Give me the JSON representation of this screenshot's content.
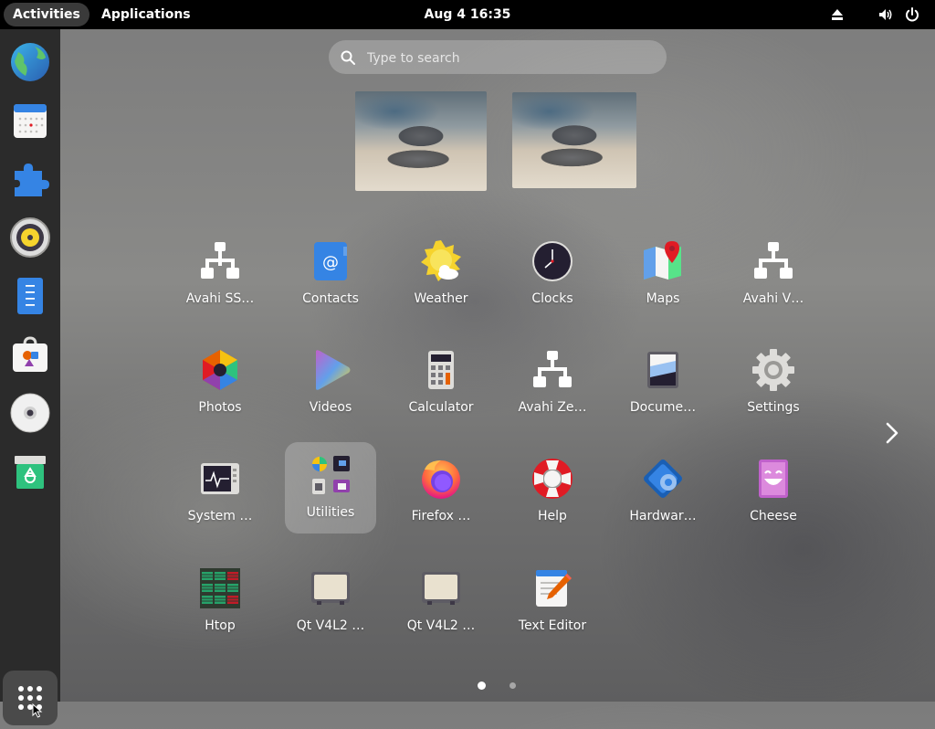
{
  "topbar": {
    "activities": "Activities",
    "applications": "Applications",
    "clock": "Aug 4  16:35",
    "tray_icons": [
      "eject-icon",
      "volume-icon",
      "power-icon"
    ]
  },
  "dock": {
    "items": [
      "web-browser-icon",
      "calendar-icon",
      "extensions-icon",
      "rhythmbox-icon",
      "text-document-icon",
      "software-store-icon",
      "disc-icon",
      "trash-icon"
    ],
    "show_apps_icon": "grid-icon"
  },
  "search": {
    "placeholder": "Type to search",
    "value": ""
  },
  "workspaces": [
    "workspace-1",
    "workspace-2"
  ],
  "apps": [
    {
      "label": "Avahi SS…",
      "icon": "network-icon"
    },
    {
      "label": "Contacts",
      "icon": "contacts-icon"
    },
    {
      "label": "Weather",
      "icon": "weather-icon"
    },
    {
      "label": "Clocks",
      "icon": "clock-icon"
    },
    {
      "label": "Maps",
      "icon": "maps-icon"
    },
    {
      "label": "Avahi V…",
      "icon": "network-icon"
    },
    {
      "label": "Photos",
      "icon": "photos-icon"
    },
    {
      "label": "Videos",
      "icon": "videos-icon"
    },
    {
      "label": "Calculator",
      "icon": "calculator-icon"
    },
    {
      "label": "Avahi Ze…",
      "icon": "network-icon"
    },
    {
      "label": "Docume…",
      "icon": "document-scanner-icon"
    },
    {
      "label": "Settings",
      "icon": "gear-icon"
    },
    {
      "label": "System …",
      "icon": "system-monitor-icon"
    },
    {
      "label": "Utilities",
      "icon": "folder-grid-icon",
      "selected": true
    },
    {
      "label": "Firefox …",
      "icon": "firefox-icon"
    },
    {
      "label": "Help",
      "icon": "lifebuoy-icon"
    },
    {
      "label": "Hardwar…",
      "icon": "hardware-icon"
    },
    {
      "label": "Cheese",
      "icon": "cheese-icon"
    },
    {
      "label": "Htop",
      "icon": "htop-icon"
    },
    {
      "label": "Qt V4L2 …",
      "icon": "webcam-icon"
    },
    {
      "label": "Qt V4L2 …",
      "icon": "webcam-icon"
    },
    {
      "label": "Text Editor",
      "icon": "text-editor-icon"
    }
  ],
  "pagination": {
    "pages": 2,
    "current": 1
  },
  "colors": {
    "topbar": "#000000",
    "dock": "#2b2b2b",
    "accent_blue": "#3584e4"
  }
}
